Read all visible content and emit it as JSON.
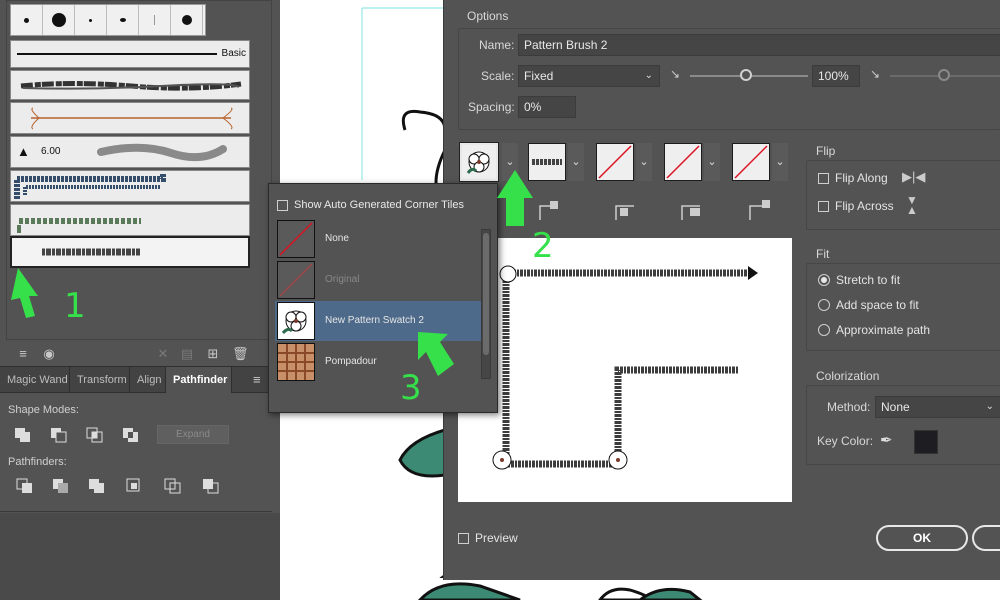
{
  "brushes_panel": {
    "basic_label": "Basic",
    "size_label": "6.00"
  },
  "tabs": [
    {
      "label": "Magic Wand"
    },
    {
      "label": "Transform"
    },
    {
      "label": "Align"
    },
    {
      "label": "Pathfinder"
    }
  ],
  "pathfinder": {
    "shape_modes_label": "Shape Modes:",
    "pathfinders_label": "Pathfinders:",
    "expand_label": "Expand"
  },
  "popup": {
    "show_corner_tiles_label": "Show Auto Generated Corner Tiles",
    "items": [
      {
        "label": "None"
      },
      {
        "label": "Original"
      },
      {
        "label": "New Pattern Swatch 2"
      },
      {
        "label": "Pompadour"
      }
    ]
  },
  "dialog": {
    "options_title": "Options",
    "name_label": "Name:",
    "name_value": "Pattern Brush 2",
    "scale_label": "Scale:",
    "scale_value": "Fixed",
    "scale_percent": "100%",
    "spacing_label": "Spacing:",
    "spacing_value": "0%",
    "flip_title": "Flip",
    "flip_along_label": "Flip Along",
    "flip_across_label": "Flip Across",
    "fit_title": "Fit",
    "fit_options": [
      {
        "label": "Stretch to fit",
        "selected": true
      },
      {
        "label": "Add space to fit",
        "selected": false
      },
      {
        "label": "Approximate path",
        "selected": false
      }
    ],
    "colorization_title": "Colorization",
    "method_label": "Method:",
    "method_value": "None",
    "key_color_label": "Key Color:",
    "preview_label": "Preview",
    "ok_label": "OK"
  },
  "annotations": [
    "1",
    "2",
    "3"
  ],
  "colors": {
    "panel_bg": "#535353",
    "highlight": "#4e6a8a",
    "annotation_green": "#35e04a"
  }
}
